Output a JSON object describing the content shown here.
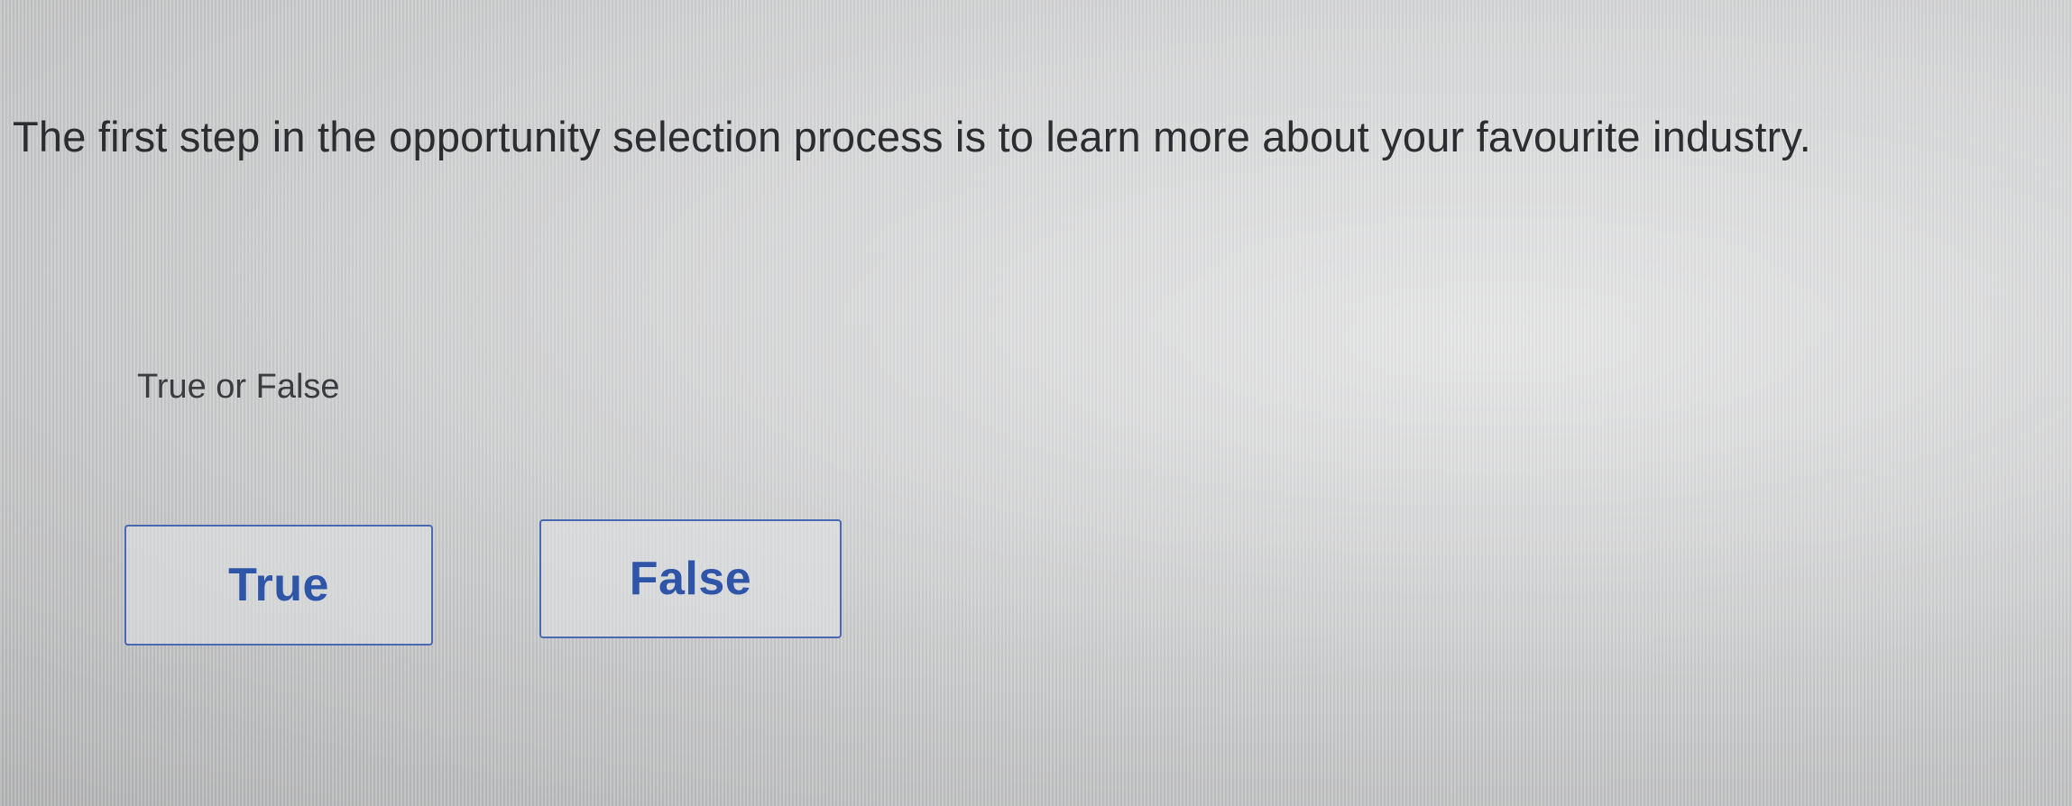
{
  "question": {
    "text": "The first step in the opportunity selection process is to learn more about your favourite industry."
  },
  "prompt": {
    "text": "True or False"
  },
  "choices": [
    {
      "label": "True"
    },
    {
      "label": "False"
    }
  ],
  "colors": {
    "accent": "#2f55a8",
    "button_border": "#4a69b3",
    "text": "#2b2d30"
  }
}
